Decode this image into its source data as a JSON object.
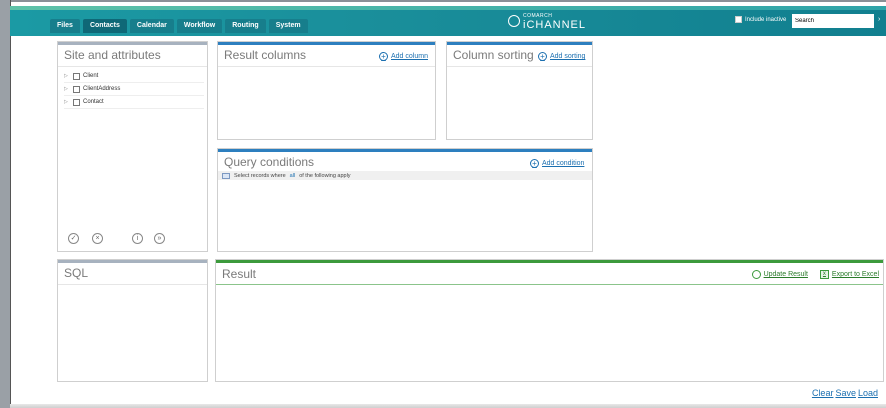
{
  "header": {
    "tabs": [
      "Files",
      "Contacts",
      "Calendar",
      "Workflow",
      "Routing",
      "System"
    ],
    "active_tab": "Contacts",
    "brand_small": "COMARCH",
    "brand_name": "iCHANNEL",
    "include_inactive_label": "Include inactive",
    "search_value": "Search"
  },
  "site_panel": {
    "title": "Site and attributes",
    "items": [
      {
        "label": "Client"
      },
      {
        "label": "ClientAddress"
      },
      {
        "label": "Contact"
      }
    ],
    "icons": [
      "check-circle-icon",
      "cancel-circle-icon",
      "info-circle-icon",
      "forward-circle-icon"
    ]
  },
  "result_columns": {
    "title": "Result columns",
    "add_label": "Add column"
  },
  "column_sorting": {
    "title": "Column sorting",
    "add_label": "Add sorting"
  },
  "query_conditions": {
    "title": "Query conditions",
    "add_label": "Add condition",
    "select_text_before": "Select records where",
    "select_mode": "all",
    "select_text_after": "of the following apply"
  },
  "sql_panel": {
    "title": "SQL"
  },
  "result_panel": {
    "title": "Result",
    "update_label": "Update Result",
    "export_label": "Export to Excel"
  },
  "footer": {
    "clear": "Clear",
    "save": "Save",
    "load": "Load"
  },
  "colors": {
    "header_teal": "#1a8f9b",
    "accent_blue": "#2d7fbf",
    "result_green": "#3c9a3c"
  }
}
